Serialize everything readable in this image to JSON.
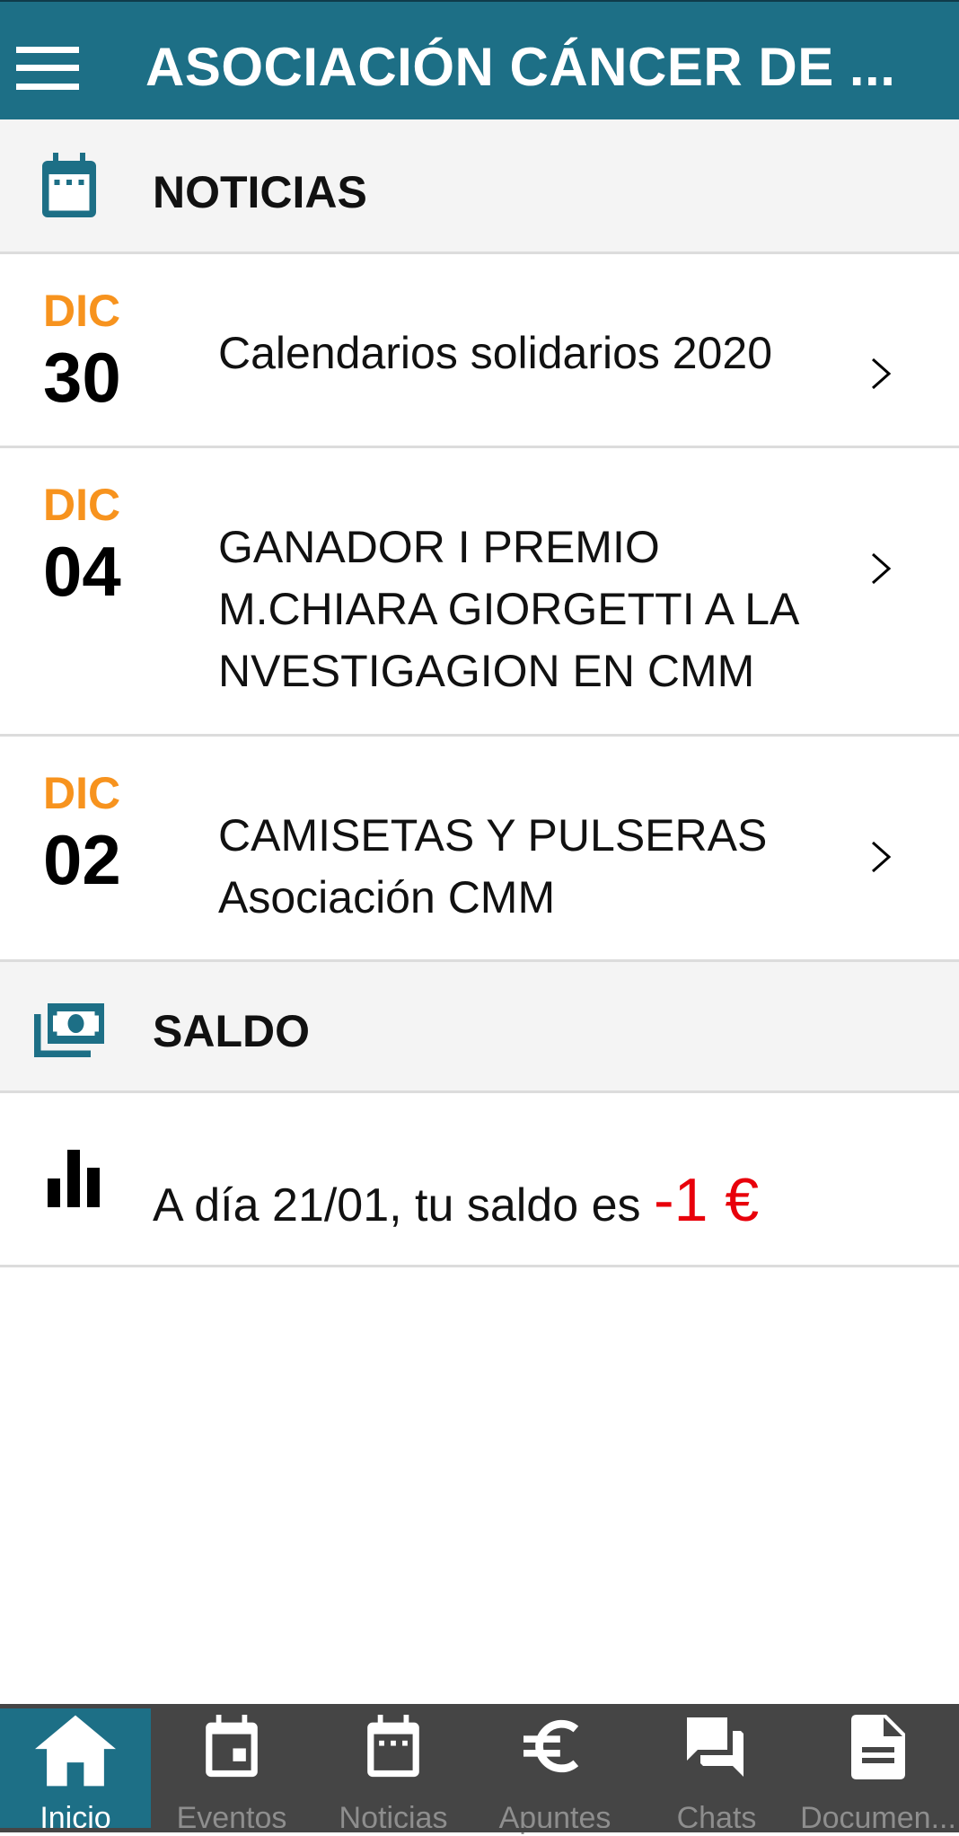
{
  "colors": {
    "brand": "#1d6f86",
    "accent_date": "#f7931e",
    "negative": "#e8000b",
    "nav_bg": "#454545"
  },
  "header": {
    "menu_icon": "hamburger-menu-icon",
    "title": "ASOCIACIÓN CÁNCER DE ..."
  },
  "noticias": {
    "icon": "calendar-icon",
    "label": "NOTICIAS",
    "items": [
      {
        "month": "DIC",
        "day": "30",
        "title": "Calendarios solidarios 2020"
      },
      {
        "month": "DIC",
        "day": "04",
        "title": "GANADOR I PREMIO M.CHIARA GIORGETTI A LA NVESTIGAGION EN CMM"
      },
      {
        "month": "DIC",
        "day": "02",
        "title": "CAMISETAS Y PULSERAS Asociación CMM"
      }
    ]
  },
  "saldo": {
    "icon": "money-icon",
    "label": "SALDO",
    "row_icon": "bar-chart-icon",
    "text": "A día 21/01, tu saldo es",
    "amount": "-1 €"
  },
  "bottom_nav": {
    "tabs": [
      {
        "label": "Inicio",
        "icon": "home-icon",
        "active": true
      },
      {
        "label": "Eventos",
        "icon": "event-icon",
        "active": false
      },
      {
        "label": "Noticias",
        "icon": "calendar-icon",
        "active": false
      },
      {
        "label": "Apuntes",
        "icon": "euro-icon",
        "active": false
      },
      {
        "label": "Chats",
        "icon": "chat-icon",
        "active": false
      },
      {
        "label": "Documen...",
        "icon": "document-icon",
        "active": false
      }
    ]
  }
}
